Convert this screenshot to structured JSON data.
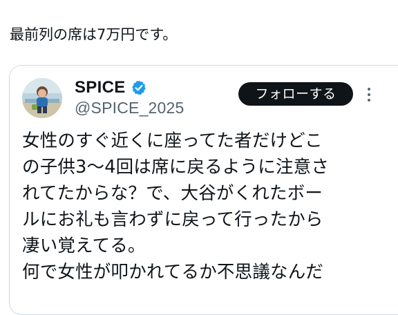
{
  "post": {
    "text": "最前列の席は7万円です。"
  },
  "embed": {
    "author": {
      "display_name": "SPICE",
      "handle": "@SPICE_2025",
      "verified": true
    },
    "follow_label": "フォローする",
    "lines": [
      "女性のすぐ近くに座ってた者だけどこ",
      "の子供3〜4回は席に戻るように注意さ",
      "れてたからな？で、大谷がくれたボー",
      "ルにお礼も言わずに戻って行ったから",
      "凄い覚えてる。",
      "何で女性が叩かれてるか不思議なんだ"
    ]
  },
  "icons": {
    "verified": "verified-badge-icon",
    "more": "more-options-icon"
  },
  "colors": {
    "text": "#0f1419",
    "secondary_text": "#536471",
    "verified_blue": "#1d9bf0",
    "follow_bg": "#0f1419",
    "border": "#cfd9de"
  }
}
